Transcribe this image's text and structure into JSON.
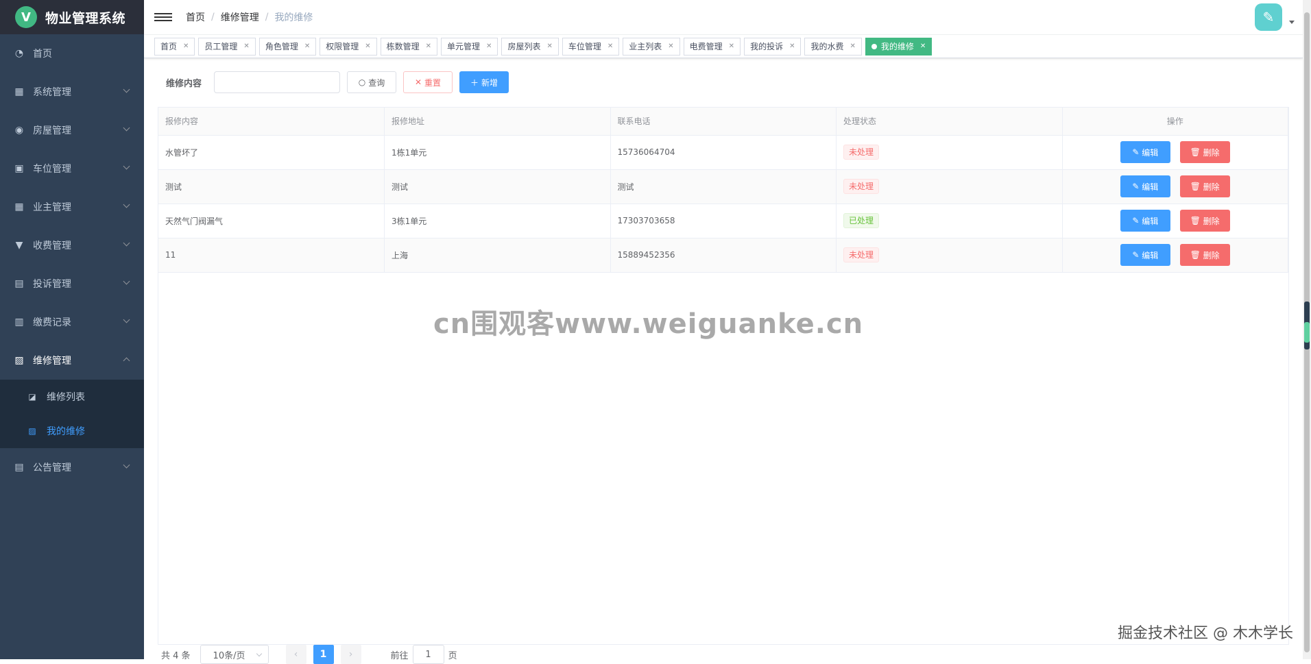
{
  "app": {
    "logo_letter": "V",
    "title": "物业管理系统"
  },
  "sidebar": {
    "items": [
      {
        "label": "首页",
        "icon": "dashboard-icon"
      },
      {
        "label": "系统管理",
        "icon": "grid-icon"
      },
      {
        "label": "房屋管理",
        "icon": "home-icon"
      },
      {
        "label": "车位管理",
        "icon": "parking-icon"
      },
      {
        "label": "业主管理",
        "icon": "table-icon"
      },
      {
        "label": "收费管理",
        "icon": "payment-icon"
      },
      {
        "label": "投诉管理",
        "icon": "calendar-icon"
      },
      {
        "label": "缴费记录",
        "icon": "record-icon"
      },
      {
        "label": "维修管理",
        "icon": "image-icon"
      },
      {
        "label": "公告管理",
        "icon": "notice-icon"
      }
    ],
    "submenu": [
      {
        "label": "维修列表",
        "icon": "chart-icon"
      },
      {
        "label": "我的维修",
        "icon": "picture-icon"
      }
    ]
  },
  "breadcrumb": [
    "首页",
    "维修管理",
    "我的维修"
  ],
  "tags": [
    "首页",
    "员工管理",
    "角色管理",
    "权限管理",
    "栋数管理",
    "单元管理",
    "房屋列表",
    "车位管理",
    "业主列表",
    "电费管理",
    "我的投诉",
    "我的水费",
    "我的维修"
  ],
  "search": {
    "label": "维修内容",
    "value": "",
    "query_label": "查询",
    "reset_label": "重置",
    "add_label": "新增"
  },
  "table": {
    "headers": [
      "报修内容",
      "报修地址",
      "联系电话",
      "处理状态",
      "操作"
    ],
    "rows": [
      {
        "content": "水管坏了",
        "address": "1栋1单元",
        "phone": "15736064704",
        "status": "未处理"
      },
      {
        "content": "测试",
        "address": "测试",
        "phone": "测试",
        "status": "未处理"
      },
      {
        "content": "天然气门阀漏气",
        "address": "3栋1单元",
        "phone": "17303703658",
        "status": "已处理"
      },
      {
        "content": "11",
        "address": "上海",
        "phone": "15889452356",
        "status": "未处理"
      }
    ],
    "edit_label": "编辑",
    "delete_label": "删除"
  },
  "pagination": {
    "total": "共 4 条",
    "page_size": "10条/页",
    "current": "1",
    "goto_prefix": "前往",
    "goto_value": "1",
    "goto_suffix": "页"
  },
  "watermark": "cn围观客www.weiguanke.cn",
  "corner_mark": "掘金技术社区 @ 木木学长",
  "colors": {
    "primary": "#409eff",
    "danger": "#f56c6c",
    "success": "#67c23a",
    "sidebar": "#304156",
    "active_tag": "#42b983"
  }
}
